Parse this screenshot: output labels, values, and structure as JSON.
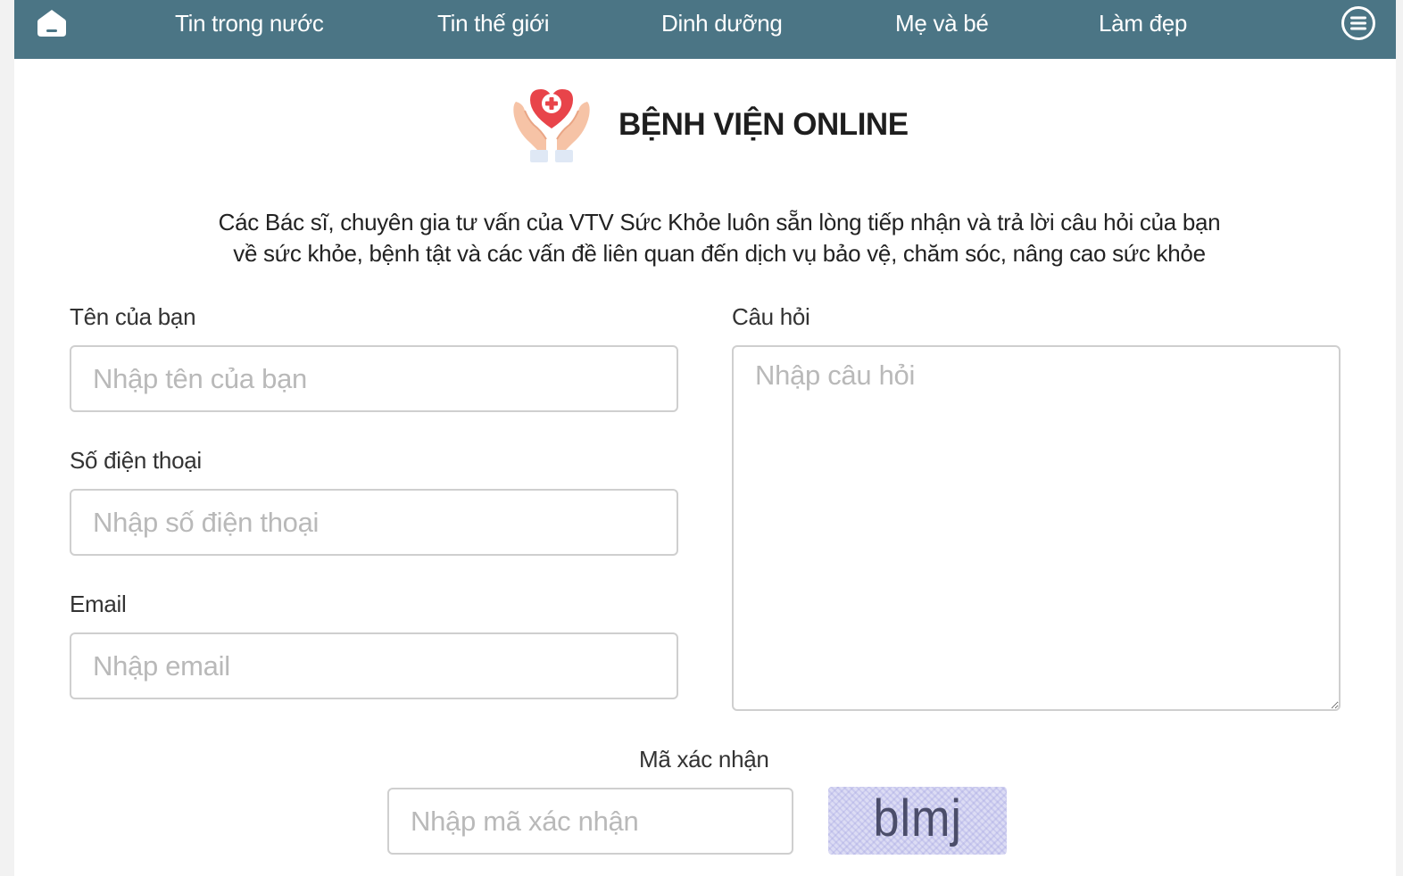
{
  "nav": {
    "home_icon": "home-icon",
    "menu_icon": "hamburger-menu-icon",
    "items": [
      {
        "label": "Tin trong nước"
      },
      {
        "label": "Tin thế giới"
      },
      {
        "label": "Dinh dưỡng"
      },
      {
        "label": "Mẹ và bé"
      },
      {
        "label": "Làm đẹp"
      }
    ],
    "bar_color": "#4b7585"
  },
  "brand": {
    "logo_icon": "hands-heart-medical-cross-icon",
    "title": "BỆNH VIỆN ONLINE"
  },
  "intro": {
    "line1": "Các Bác sĩ, chuyên gia tư vấn của VTV Sức Khỏe luôn sẵn lòng tiếp nhận và trả lời câu hỏi của bạn",
    "line2": "về sức khỏe, bệnh tật và các vấn đề liên quan đến dịch vụ bảo vệ, chăm sóc, nâng cao sức khỏe"
  },
  "form": {
    "name": {
      "label": "Tên của bạn",
      "placeholder": "Nhập tên của bạn",
      "value": ""
    },
    "phone": {
      "label": "Số điện thoại",
      "placeholder": "Nhập số điện thoại",
      "value": ""
    },
    "email": {
      "label": "Email",
      "placeholder": "Nhập email",
      "value": ""
    },
    "question": {
      "label": "Câu hỏi",
      "placeholder": "Nhập câu hỏi",
      "value": ""
    },
    "captcha": {
      "label": "Mã xác nhận",
      "placeholder": "Nhập mã xác nhận",
      "image_text": "blmj"
    }
  }
}
